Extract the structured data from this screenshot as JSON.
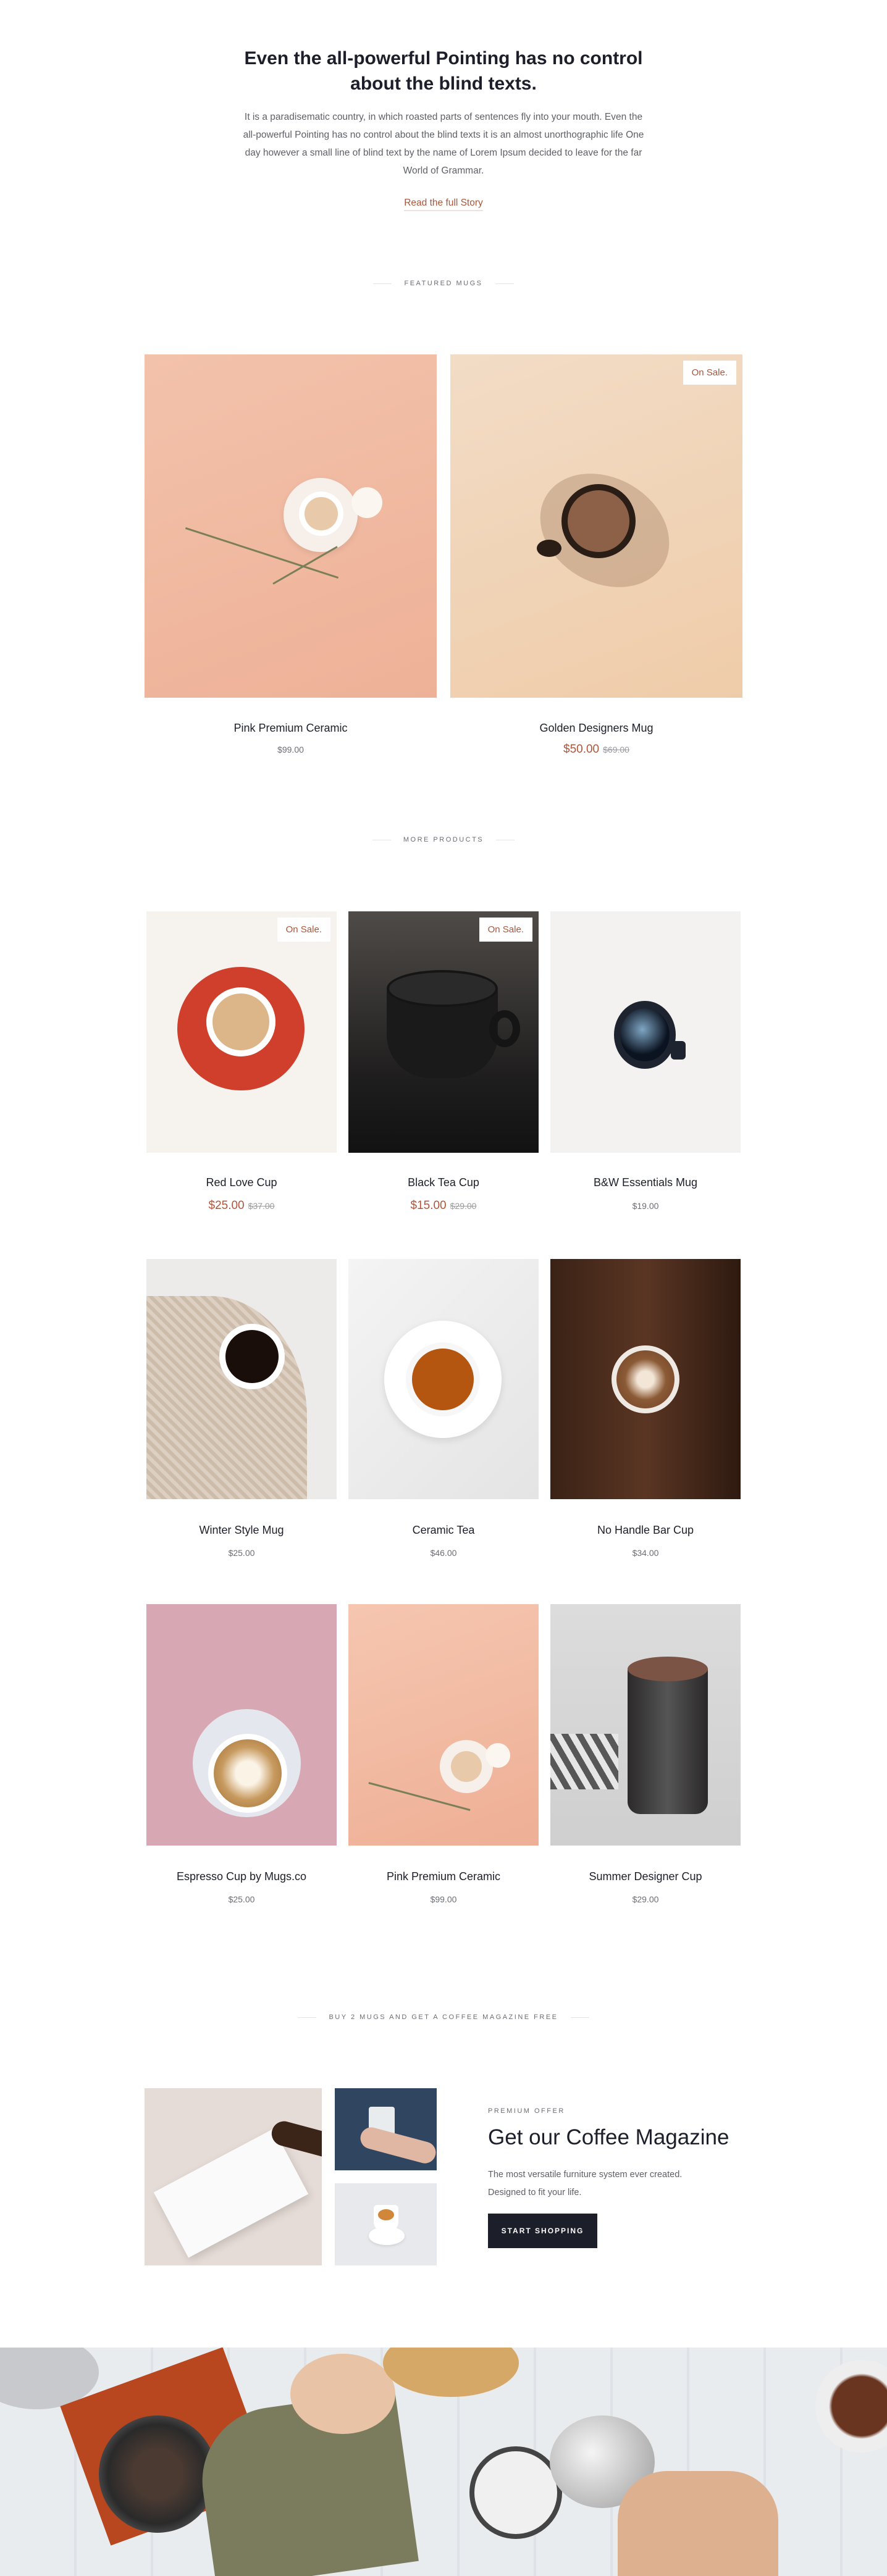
{
  "intro": {
    "title": "Even the all-powerful Pointing has no control about the blind texts.",
    "text": "It is a paradisematic country, in which roasted parts of sentences fly into your mouth. Even the all-powerful Pointing has no control about the blind texts it is an almost unorthographic life One day however a small line of blind text by the name of Lorem Ipsum decided to leave for the far World of Grammar.",
    "link": "Read the full Story"
  },
  "featured": {
    "label": "Featured Mugs",
    "products": [
      {
        "name": "Pink Premium Ceramic",
        "price": "$99.00"
      },
      {
        "name": "Golden Designers Mug",
        "price": "$50.00",
        "old_price": "$69.00",
        "badge": "On Sale."
      }
    ]
  },
  "more": {
    "label": "More Products",
    "products": [
      {
        "name": "Red Love Cup",
        "price": "$25.00",
        "old_price": "$37.00",
        "badge": "On Sale."
      },
      {
        "name": "Black Tea Cup",
        "price": "$15.00",
        "old_price": "$29.00",
        "badge": "On Sale."
      },
      {
        "name": "B&W Essentials Mug",
        "price": "$19.00"
      },
      {
        "name": "Winter Style Mug",
        "price": "$25.00"
      },
      {
        "name": "Ceramic Tea",
        "price": "$46.00"
      },
      {
        "name": "No Handle Bar Cup",
        "price": "$34.00"
      },
      {
        "name": "Espresso Cup by Mugs.co",
        "price": "$25.00"
      },
      {
        "name": "Pink Premium Ceramic",
        "price": "$99.00"
      },
      {
        "name": "Summer Designer Cup",
        "price": "$29.00"
      }
    ]
  },
  "promo": {
    "label": "Buy 2 mugs and get a coffee magazine free",
    "eyebrow": "Premium Offer",
    "title": "Get our Coffee Magazine",
    "text_line1": "The most versatile furniture system ever created.",
    "text_line2": "Designed to fit your life.",
    "button": "Start Shopping"
  },
  "colors": {
    "accent": "#b0553a",
    "dark": "#1c1e2a"
  }
}
